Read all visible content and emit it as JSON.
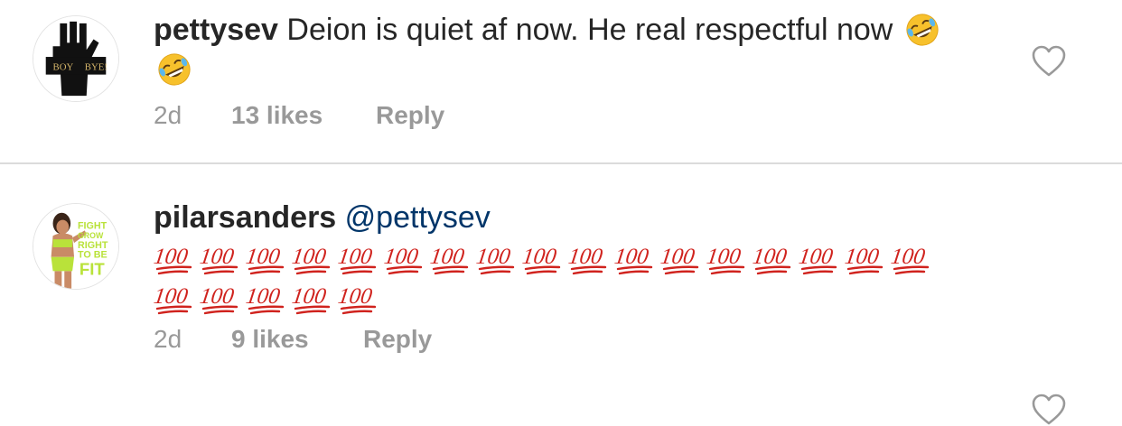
{
  "comments": [
    {
      "username": "pettysev",
      "text": "Deion is quiet af now. He real respectful now",
      "emoji": [
        "rolling-on-floor-laughing",
        "rolling-on-floor-laughing"
      ],
      "age": "2d",
      "likes": "13 likes",
      "reply_label": "Reply",
      "avatar_text_left": "BOY",
      "avatar_text_right": "BYE!"
    },
    {
      "username": "pilarsanders",
      "mention": "@pettysev",
      "emoji_repeat": {
        "glyph": "hundred-points",
        "count": 22,
        "label": "100"
      },
      "age": "2d",
      "likes": "9 likes",
      "reply_label": "Reply",
      "avatar_text": [
        "FIGHT",
        "GROW",
        "RIGHT",
        "TO BE",
        "FIT"
      ]
    }
  ],
  "colors": {
    "username": "#262626",
    "mention": "#003569",
    "meta": "#999999",
    "divider": "#dbdbdb",
    "hundred_red": "#d0231e",
    "avatar_green": "#b9e23a"
  },
  "icons": [
    "heart-outline-icon",
    "heart-outline-icon"
  ]
}
